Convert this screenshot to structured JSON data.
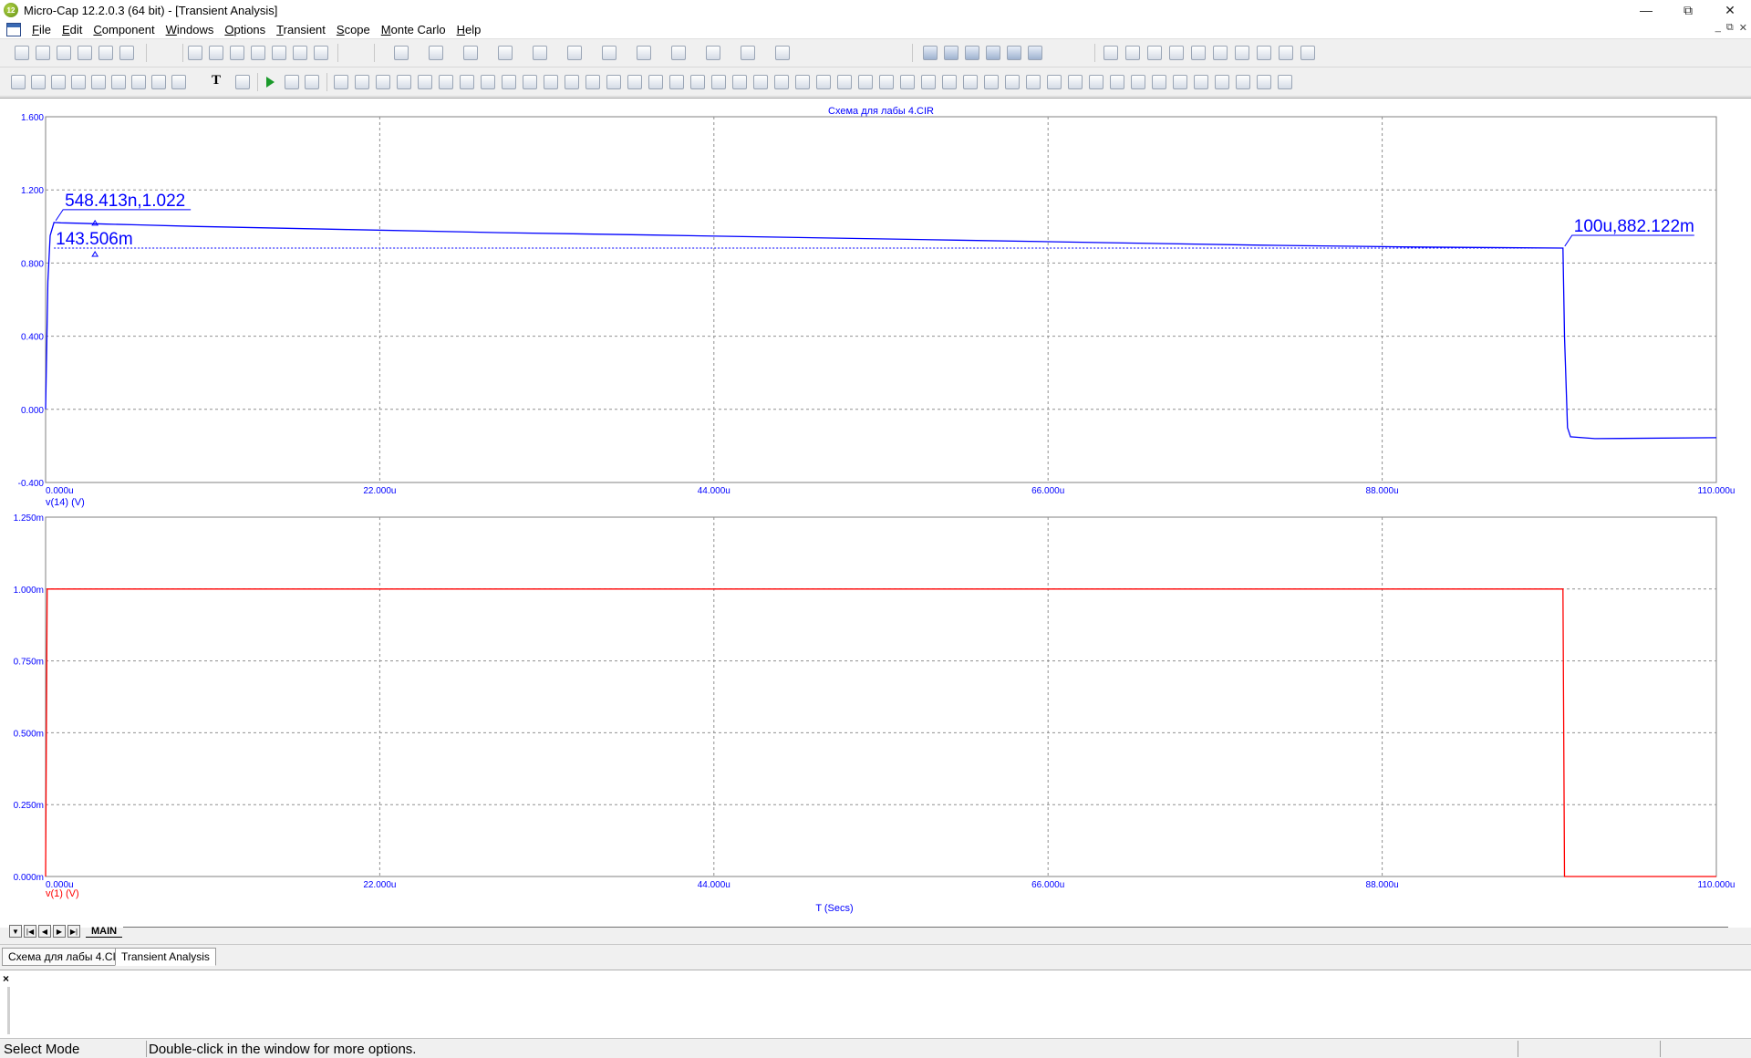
{
  "window": {
    "title": "Micro-Cap 12.2.0.3 (64 bit) - [Transient Analysis]",
    "app_icon": "micro-cap-logo",
    "app_icon_text": "12"
  },
  "menu": [
    {
      "key": "F",
      "rest": "ile"
    },
    {
      "key": "E",
      "rest": "dit"
    },
    {
      "key": "C",
      "rest": "omponent"
    },
    {
      "key": "W",
      "rest": "indows"
    },
    {
      "key": "O",
      "rest": "ptions"
    },
    {
      "key": "T",
      "rest": "ransient"
    },
    {
      "key": "S",
      "rest": "cope"
    },
    {
      "key": "M",
      "rest": "onte Carlo"
    },
    {
      "key": "H",
      "rest": "elp"
    }
  ],
  "toolbar": {
    "text_tool_glyph": "T",
    "accent_color": "#1a9a2a"
  },
  "plot": {
    "title": "Схема для лабы 4.CIR",
    "x_axis_label": "T (Secs)",
    "x_ticks": [
      "0.000u",
      "22.000u",
      "44.000u",
      "66.000u",
      "88.000u",
      "110.000u"
    ],
    "top_panel": {
      "y_ticks": [
        "1.600",
        "1.200",
        "0.800",
        "0.400",
        "0.000",
        "-0.400"
      ],
      "trace_label": "v(14) (V)",
      "trace_color": "#0000ff",
      "cursor_label_1": "548.413n,1.022",
      "cursor_delta": "143.506m",
      "cursor_label_2": "100u,882.122m"
    },
    "bottom_panel": {
      "y_ticks": [
        "1.250m",
        "1.000m",
        "0.750m",
        "0.500m",
        "0.250m",
        "0.000m"
      ],
      "trace_label": "v(1) (V)",
      "trace_color": "#ff0000"
    },
    "grid": true
  },
  "chart_data": [
    {
      "type": "line",
      "title": "Схема для лабы 4.CIR",
      "xlabel": "T (Secs)",
      "ylabel": "v(14) (V)",
      "xlim": [
        0,
        110
      ],
      "ylim": [
        -0.4,
        1.6
      ],
      "grid": true,
      "series": [
        {
          "name": "v(14) (V)",
          "color": "#0000ff",
          "x": [
            0,
            0.15,
            0.3,
            0.55,
            1,
            2,
            4,
            6,
            10,
            20,
            30,
            40,
            50,
            60,
            70,
            80,
            90,
            99.9,
            100.0,
            100.2,
            100.4,
            102,
            110
          ],
          "y": [
            0.0,
            0.7,
            0.95,
            1.022,
            1.02,
            1.018,
            1.013,
            1.009,
            1.0,
            0.983,
            0.966,
            0.953,
            0.939,
            0.925,
            0.911,
            0.898,
            0.888,
            0.882,
            0.4,
            -0.1,
            -0.15,
            -0.16,
            -0.155
          ]
        }
      ],
      "annotations": [
        "548.413n,1.022",
        "143.506m",
        "100u,882.122m"
      ]
    },
    {
      "type": "line",
      "xlabel": "T (Secs)",
      "ylabel": "v(1) (V)",
      "xlim": [
        0,
        110
      ],
      "ylim": [
        0,
        0.00125
      ],
      "grid": true,
      "series": [
        {
          "name": "v(1) (V)",
          "color": "#ff0000",
          "x": [
            0,
            0.1,
            99.9,
            100.0,
            110
          ],
          "y": [
            0,
            0.001,
            0.001,
            0,
            0
          ]
        }
      ]
    }
  ],
  "page_tabs": {
    "nav_buttons": [
      "▼",
      "|◀",
      "◀",
      "▶",
      "▶|"
    ],
    "active_page": "MAIN"
  },
  "doc_tabs": [
    "Схема для лабы 4.CIR",
    "Transient Analysis"
  ],
  "output_pane": {
    "close_glyph": "×"
  },
  "status": {
    "mode": "Select Mode",
    "hint": "Double-click in the window for more options."
  }
}
